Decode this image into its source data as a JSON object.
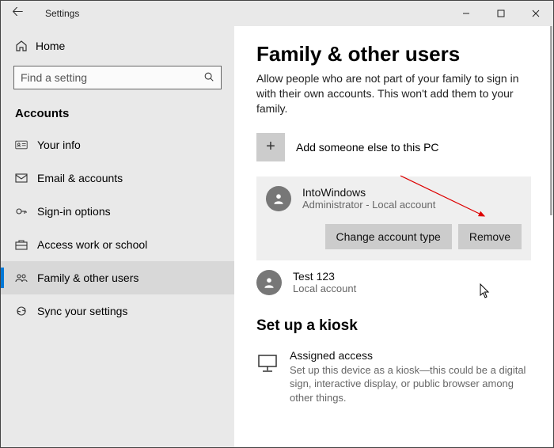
{
  "window": {
    "title": "Settings"
  },
  "sidebar": {
    "home_label": "Home",
    "search_placeholder": "Find a setting",
    "section": "Accounts",
    "items": [
      {
        "label": "Your info"
      },
      {
        "label": "Email & accounts"
      },
      {
        "label": "Sign-in options"
      },
      {
        "label": "Access work or school"
      },
      {
        "label": "Family & other users"
      },
      {
        "label": "Sync your settings"
      }
    ]
  },
  "main": {
    "title": "Family & other users",
    "description": "Allow people who are not part of your family to sign in with their own accounts. This won't add them to your family.",
    "add_label": "Add someone else to this PC",
    "selected_user": {
      "name": "IntoWindows",
      "subtitle": "Administrator - Local account",
      "change_btn": "Change account type",
      "remove_btn": "Remove"
    },
    "other_user": {
      "name": "Test 123",
      "subtitle": "Local account"
    },
    "kiosk": {
      "section_title": "Set up a kiosk",
      "title": "Assigned access",
      "desc": "Set up this device as a kiosk—this could be a digital sign, interactive display, or public browser among other things."
    }
  }
}
